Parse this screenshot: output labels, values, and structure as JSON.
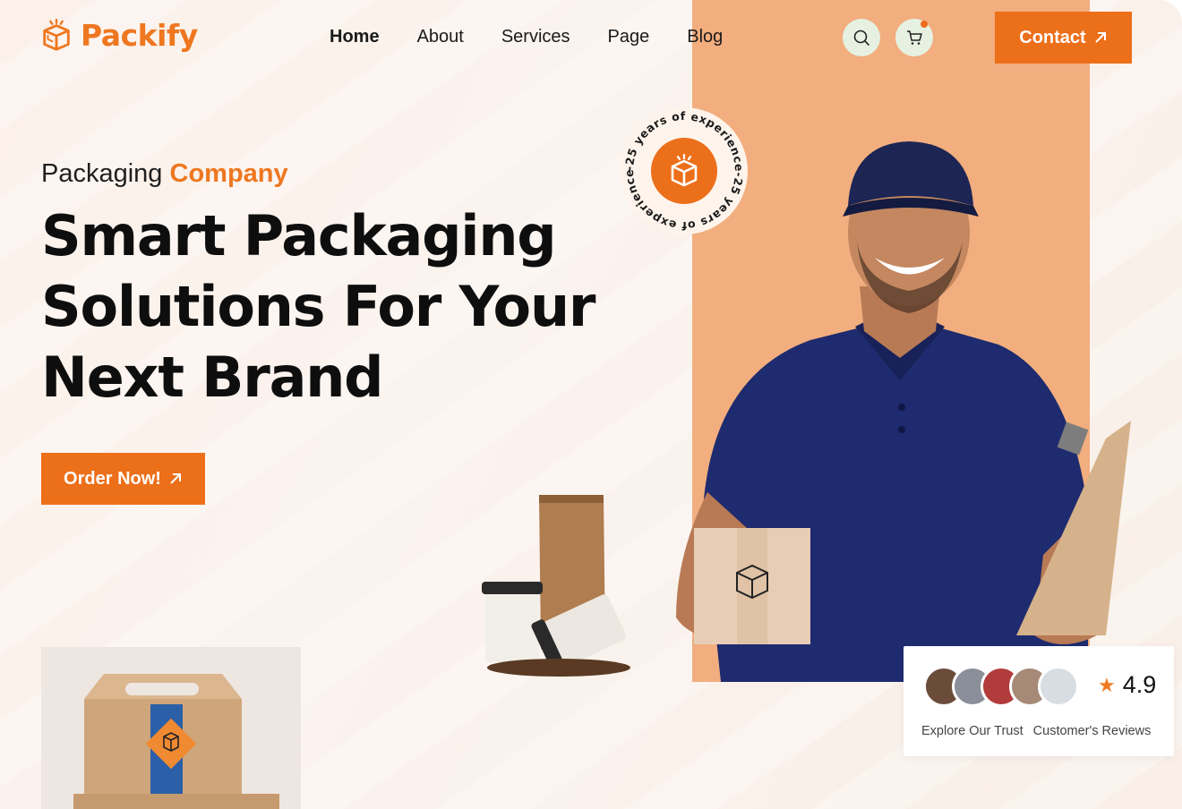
{
  "brand": {
    "name": "Packify",
    "accent": "#ec6f1a",
    "panel_color": "#f2ae7e"
  },
  "nav": {
    "items": [
      {
        "label": "Home",
        "active": true
      },
      {
        "label": "About"
      },
      {
        "label": "Services"
      },
      {
        "label": "Page"
      },
      {
        "label": "Blog"
      }
    ]
  },
  "header_icons": {
    "search": "search-icon",
    "cart": "cart-icon"
  },
  "contact_button": {
    "label": "Contact"
  },
  "hero": {
    "eyebrow_prefix": "Packaging",
    "eyebrow_accent": "Company",
    "headline_line1": "Smart Packaging",
    "headline_line2": "Solutions For Your",
    "headline_line3": "Next Brand",
    "cta_label": "Order Now!"
  },
  "badge": {
    "text": "-25 years of experience-25 years of experience"
  },
  "reviews": {
    "rating": "4.9",
    "label_left": "Explore Our Trust",
    "label_right": "Customer's Reviews"
  }
}
